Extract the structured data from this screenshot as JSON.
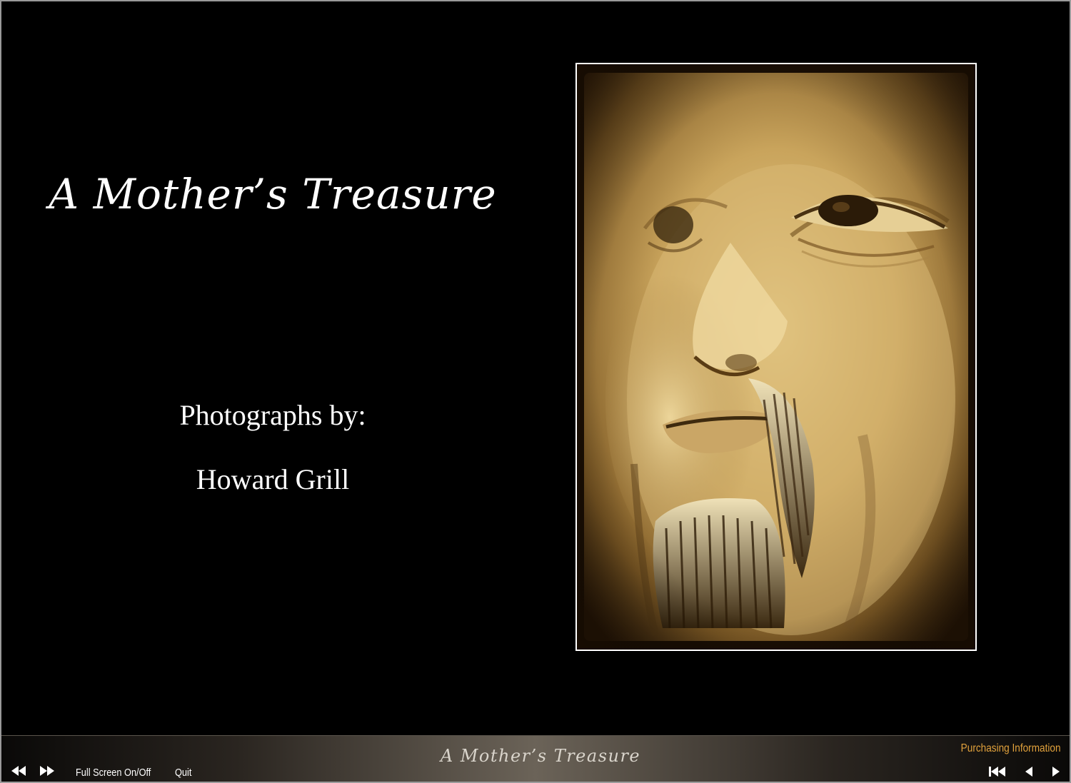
{
  "cover": {
    "title": "A Mother’s Treasure",
    "credit_label": "Photographs by:",
    "photographer": "Howard Grill"
  },
  "control_bar": {
    "rewind_icon": "rewind-icon",
    "fast_forward_icon": "fast-forward-icon",
    "fullscreen_label": "Full Screen On/Off",
    "quit_label": "Quit",
    "title": "A Mother’s Treasure",
    "purchasing_label": "Purchasing Information",
    "first_icon": "skip-to-first-icon",
    "prev_icon": "previous-icon",
    "next_icon": "next-icon"
  },
  "colors": {
    "background": "#000000",
    "accent_link": "#e2a23c",
    "text": "#ffffff"
  }
}
